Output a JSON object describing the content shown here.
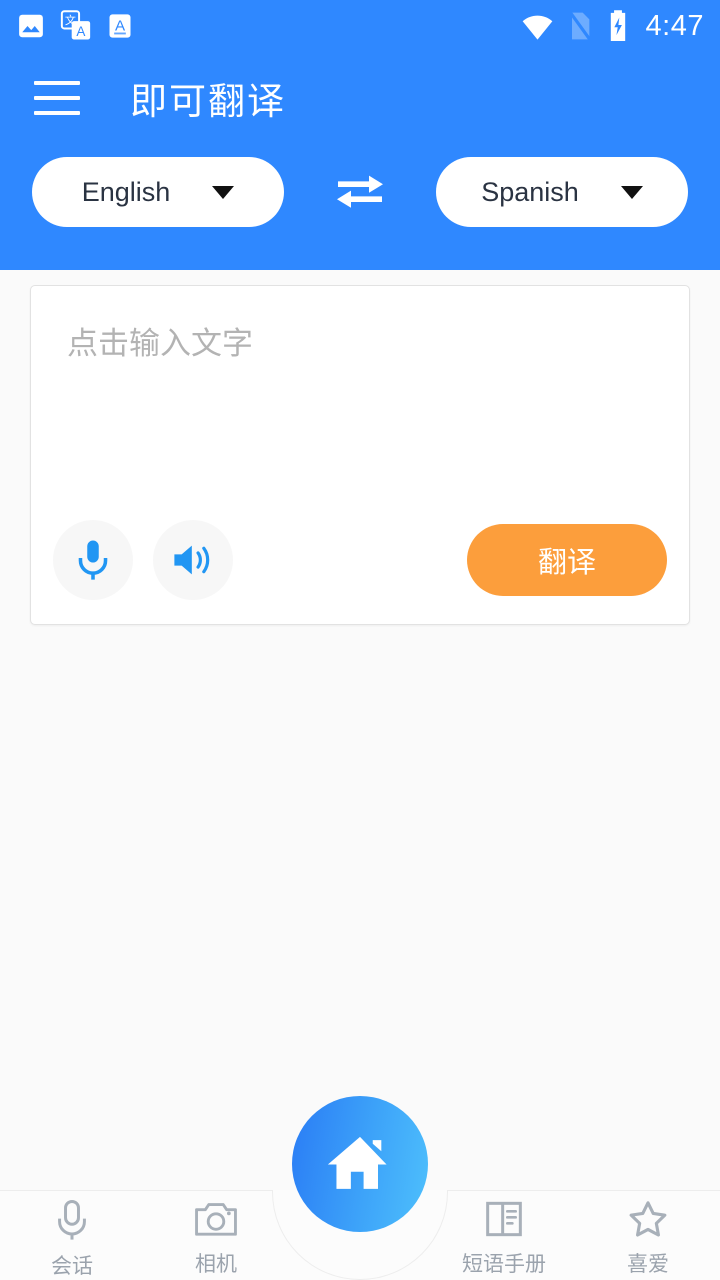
{
  "status_bar": {
    "time": "4:47",
    "notification_icons": [
      "image-icon",
      "translate-icon",
      "text-format-icon"
    ],
    "system_icons": [
      "wifi-icon",
      "sim-card-icon",
      "battery-charging-icon"
    ],
    "background_color": "#2f88ff"
  },
  "header": {
    "title": "即可翻译",
    "menu_icon": "hamburger-menu-icon",
    "background_color": "#2f88ff"
  },
  "language_selector": {
    "source_language": "English",
    "target_language": "Spanish",
    "swap_icon": "swap-horizontal-icon",
    "dropdown_icon": "caret-down-icon"
  },
  "input_card": {
    "placeholder": "点击输入文字",
    "value": "",
    "mic_icon": "microphone-icon",
    "speaker_icon": "speaker-icon",
    "translate_label": "翻译",
    "translate_color": "#fc9e3c",
    "icon_color": "#2196f3"
  },
  "bottom_nav": {
    "items": [
      {
        "label": "会话",
        "icon": "microphone-outline-icon"
      },
      {
        "label": "相机",
        "icon": "camera-outline-icon"
      },
      {
        "label": "短语手册",
        "icon": "book-outline-icon"
      },
      {
        "label": "喜爱",
        "icon": "star-outline-icon"
      }
    ],
    "home_button": {
      "icon": "home-icon",
      "gradient_from": "#2a7cf5",
      "gradient_to": "#4ec0fc"
    },
    "label_color": "#9ba3ad"
  }
}
